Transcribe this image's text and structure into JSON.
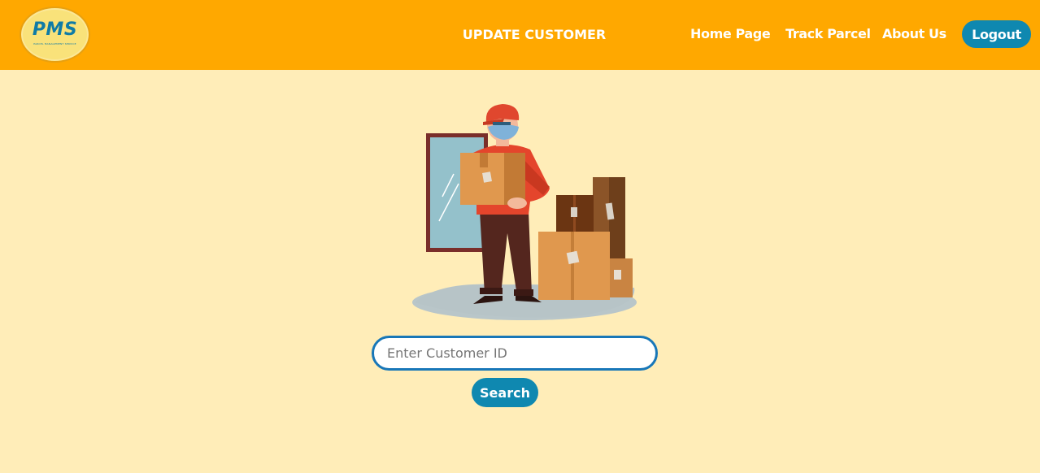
{
  "header": {
    "logo_text": "PMS",
    "logo_subtext": "PARCEL MANAGEMENT SERVICE",
    "page_title": "UPDATE CUSTOMER",
    "nav": {
      "home": "Home Page",
      "track": "Track Parcel",
      "about": "About Us"
    },
    "logout_label": "Logout"
  },
  "main": {
    "illustration": "delivery-man-carrying-boxes",
    "search_placeholder": "Enter Customer ID",
    "search_label": "Search"
  },
  "colors": {
    "navbar": "#FFA800",
    "background": "#FFEDB8",
    "button": "#0F88B0",
    "input_border": "#1877B8"
  }
}
